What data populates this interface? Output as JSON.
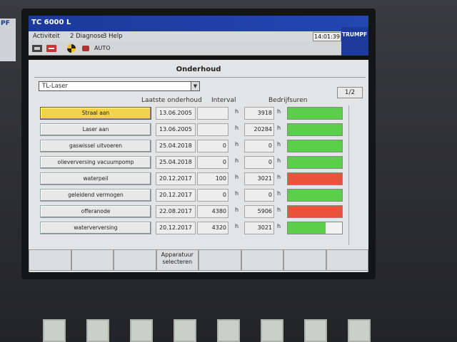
{
  "app": {
    "title": "TC 6000 L",
    "menu": [
      "Activiteit",
      "2 Diagnose",
      "3 Help"
    ],
    "clock": "14:01:39",
    "brand": "TRUMPF",
    "bezel_logo": "PF",
    "mode": "AUTO"
  },
  "section": {
    "title": "Onderhoud",
    "selector_value": "TL-Laser",
    "page_indicator": "1/2"
  },
  "columns": {
    "last_maintenance": "Laatste onderhoud",
    "interval": "Interval",
    "operating_hours": "Bedrijfsuren"
  },
  "unit": "h",
  "colors": {
    "title_bar": "#1b3a9a",
    "active_button": "#f2d248",
    "status_green": "#5ad04a",
    "status_red": "#e8533a"
  },
  "rows": [
    {
      "label": "Straal aan",
      "date": "13.06.2005",
      "interval": "",
      "hours": "3918",
      "status": "green",
      "fill": 1.0,
      "active": true
    },
    {
      "label": "Laser aan",
      "date": "13.06.2005",
      "interval": "",
      "hours": "20284",
      "status": "green",
      "fill": 1.0,
      "active": false
    },
    {
      "label": "gaswissel uitvoeren",
      "date": "25.04.2018",
      "interval": "0",
      "hours": "0",
      "status": "green",
      "fill": 1.0,
      "active": false
    },
    {
      "label": "olieverversing vacuumpomp",
      "date": "25.04.2018",
      "interval": "0",
      "hours": "0",
      "status": "green",
      "fill": 1.0,
      "active": false
    },
    {
      "label": "waterpeil",
      "date": "20.12.2017",
      "interval": "100",
      "hours": "3021",
      "status": "red",
      "fill": 1.0,
      "active": false
    },
    {
      "label": "geleidend vermogen",
      "date": "20.12.2017",
      "interval": "0",
      "hours": "0",
      "status": "green",
      "fill": 1.0,
      "active": false
    },
    {
      "label": "offeranode",
      "date": "22.08.2017",
      "interval": "4380",
      "hours": "5906",
      "status": "red",
      "fill": 1.0,
      "active": false
    },
    {
      "label": "waterverversing",
      "date": "20.12.2017",
      "interval": "4320",
      "hours": "3021",
      "status": "green",
      "fill": 0.7,
      "active": false
    }
  ],
  "softkeys": [
    "",
    "",
    "",
    "Apparatuur selecteren",
    "",
    "",
    "",
    ""
  ]
}
